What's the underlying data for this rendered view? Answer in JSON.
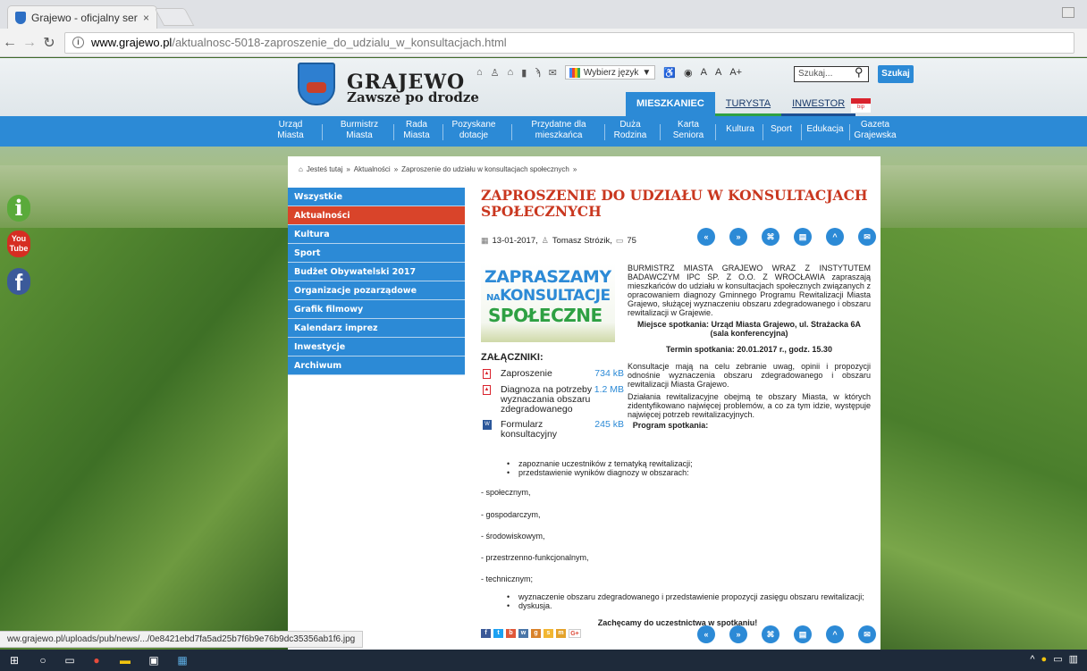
{
  "browser": {
    "tab_title": "Grajewo - oficjalny serwi",
    "tab_close": "×",
    "url_host": "www.grajewo.pl",
    "url_path": "/aktualnosc-5018-zaproszenie_do_udzialu_w_konsultacjach.html",
    "status_url": "ww.grajewo.pl/uploads/pub/news/.../0e8421ebd7fa5ad25b7f6b9e76b9dc35356ab1f6.jpg"
  },
  "header": {
    "logo_title": "GRAJEWO",
    "logo_subtitle": "Zawsze po drodze",
    "language_label": "Wybierz język",
    "language_arrow": "▼",
    "font_small": "A",
    "font_medium": "A",
    "font_large": "A+",
    "search_placeholder": "Szukaj...",
    "search_button": "Szukaj",
    "section_tabs": [
      "MIESZKANIEC",
      "TURYSTA",
      "INWESTOR"
    ],
    "bip_label": "bip"
  },
  "main_nav": [
    [
      "Urząd",
      "Miasta"
    ],
    [
      "Burmistrz",
      "Miasta"
    ],
    [
      "Rada",
      "Miasta"
    ],
    [
      "Pozyskane",
      "dotacje"
    ],
    [
      "Przydatne dla",
      "mieszkańca"
    ],
    [
      "Duża",
      "Rodzina"
    ],
    [
      "Karta",
      "Seniora"
    ],
    [
      "Kultura"
    ],
    [
      "Sport"
    ],
    [
      "Edukacja"
    ],
    [
      "Gazeta",
      "Grajewska"
    ]
  ],
  "social": {
    "info": "i",
    "youtube_1": "You",
    "youtube_2": "Tube",
    "facebook": "f"
  },
  "breadcrumb": {
    "home_icon": "⌂",
    "label": "Jesteś tutaj",
    "sep": "»",
    "items": [
      "Aktualności",
      "Zaproszenie do udziału w konsultacjach społecznych"
    ]
  },
  "left_menu": [
    "Wszystkie",
    "Aktualności",
    "Kultura",
    "Sport",
    "Budżet Obywatelski 2017",
    "Organizacje pozarządowe",
    "Grafik filmowy",
    "Kalendarz imprez",
    "Inwestycje",
    "Archiwum"
  ],
  "left_menu_active": 1,
  "article": {
    "title": "ZAPROSZENIE DO UDZIAŁU W KONSULTACJACH SPOŁECZNYCH",
    "date": "13-01-2017,",
    "author": "Tomasz Strózik,",
    "views": "75",
    "promo_line1": "ZAPRASZAMY",
    "promo_line2_small": "NA",
    "promo_line2": "KONSULTACJE",
    "promo_line3": "SPOŁECZNE",
    "intro": "BURMISTRZ MIASTA GRAJEWO WRAZ Z INSTYTUTEM BADAWCZYM IPC SP. Z O.O. Z WROCŁAWIA zapraszają mieszkańców do udziału w konsultacjach społecznych związanych z opracowaniem diagnozy Gminnego Programu Rewitalizacji Miasta Grajewo, służącej wyznaczeniu obszaru zdegradowanego i obszaru rewitalizacji w Grajewie.",
    "meeting_place": "Miejsce spotkania: Urząd Miasta Grajewo, ul. Strażacka 6A (sala konferencyjna)",
    "meeting_time": "Termin spotkania: 20.01.2017 r., godz. 15.30",
    "para1": "Konsultacje mają na celu zebranie uwag, opinii i propozycji odnośnie wyznaczenia obszaru zdegradowanego i obszaru rewitalizacji Miasta Grajewo.",
    "para2": "Działania rewitalizacyjne obejmą te obszary Miasta, w których zidentyfikowano najwięcej problemów, a co za tym idzie, występuje najwięcej potrzeb rewitalizacyjnych.",
    "program_heading": "Program spotkania:",
    "bullets1": [
      "zapoznanie uczestników z tematyką rewitalizacji;",
      "przedstawienie wyników diagnozy w obszarach:"
    ],
    "dashes": [
      "- społecznym,",
      "- gospodarczym,",
      "- środowiskowym,",
      "- przestrzenno-funkcjonalnym,",
      "- technicznym;"
    ],
    "bullets2": [
      "wyznaczenie obszaru zdegradowanego i przedstawienie propozycji zasięgu obszaru rewitalizacji;",
      "dyskusja."
    ],
    "closing": "Zachęcamy do uczestnictwa w spotkaniu!"
  },
  "attachments": {
    "heading": "ZAŁĄCZNIKI:",
    "items": [
      {
        "name": "Zaproszenie",
        "size": "734 kB",
        "type": "pdf"
      },
      {
        "name": "Diagnoza na potrzeby wyznaczania obszaru zdegradowanego",
        "size": "1.2 MB",
        "type": "pdf"
      },
      {
        "name": "Formularz konsultacyjny",
        "size": "245 kB",
        "type": "doc"
      }
    ]
  },
  "action_icons": [
    "«",
    "»",
    "pdf",
    "print",
    "^",
    "mail"
  ],
  "share_icons": [
    "f",
    "t",
    "b",
    "w",
    "g",
    "s",
    "m",
    "G+"
  ],
  "colors": {
    "brand_blue": "#2c8ad6",
    "active_red": "#d9442a",
    "title_red": "#c9371f"
  }
}
